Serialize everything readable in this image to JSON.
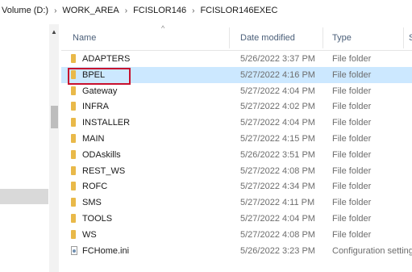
{
  "breadcrumb": {
    "items": [
      "Volume (D:)",
      "WORK_AREA",
      "FCISLOR146",
      "FCISLOR146EXEC"
    ],
    "separator": "›"
  },
  "columns": {
    "name": "Name",
    "date_modified": "Date modified",
    "type": "Type",
    "size": "S"
  },
  "rows": [
    {
      "name": "ADAPTERS",
      "date": "5/26/2022 3:37 PM",
      "type": "File folder",
      "icon": "folder-icon"
    },
    {
      "name": "BPEL",
      "date": "5/27/2022 4:16 PM",
      "type": "File folder",
      "icon": "folder-icon",
      "selected": true
    },
    {
      "name": "Gateway",
      "date": "5/27/2022 4:04 PM",
      "type": "File folder",
      "icon": "folder-icon"
    },
    {
      "name": "INFRA",
      "date": "5/27/2022 4:02 PM",
      "type": "File folder",
      "icon": "folder-icon"
    },
    {
      "name": "INSTALLER",
      "date": "5/27/2022 4:04 PM",
      "type": "File folder",
      "icon": "folder-icon"
    },
    {
      "name": "MAIN",
      "date": "5/27/2022 4:15 PM",
      "type": "File folder",
      "icon": "folder-icon"
    },
    {
      "name": "ODAskills",
      "date": "5/26/2022 3:51 PM",
      "type": "File folder",
      "icon": "folder-icon"
    },
    {
      "name": "REST_WS",
      "date": "5/27/2022 4:08 PM",
      "type": "File folder",
      "icon": "folder-icon"
    },
    {
      "name": "ROFC",
      "date": "5/27/2022 4:34 PM",
      "type": "File folder",
      "icon": "folder-icon"
    },
    {
      "name": "SMS",
      "date": "5/27/2022 4:11 PM",
      "type": "File folder",
      "icon": "folder-icon"
    },
    {
      "name": "TOOLS",
      "date": "5/27/2022 4:04 PM",
      "type": "File folder",
      "icon": "folder-icon"
    },
    {
      "name": "WS",
      "date": "5/27/2022 4:08 PM",
      "type": "File folder",
      "icon": "folder-icon"
    },
    {
      "name": "FCHome.ini",
      "date": "5/26/2022 3:23 PM",
      "type": "Configuration settings",
      "icon": "config-file-icon"
    }
  ],
  "colors": {
    "selection": "#cce8ff",
    "highlight_box": "#c8102e",
    "folder": "#e9b949"
  }
}
